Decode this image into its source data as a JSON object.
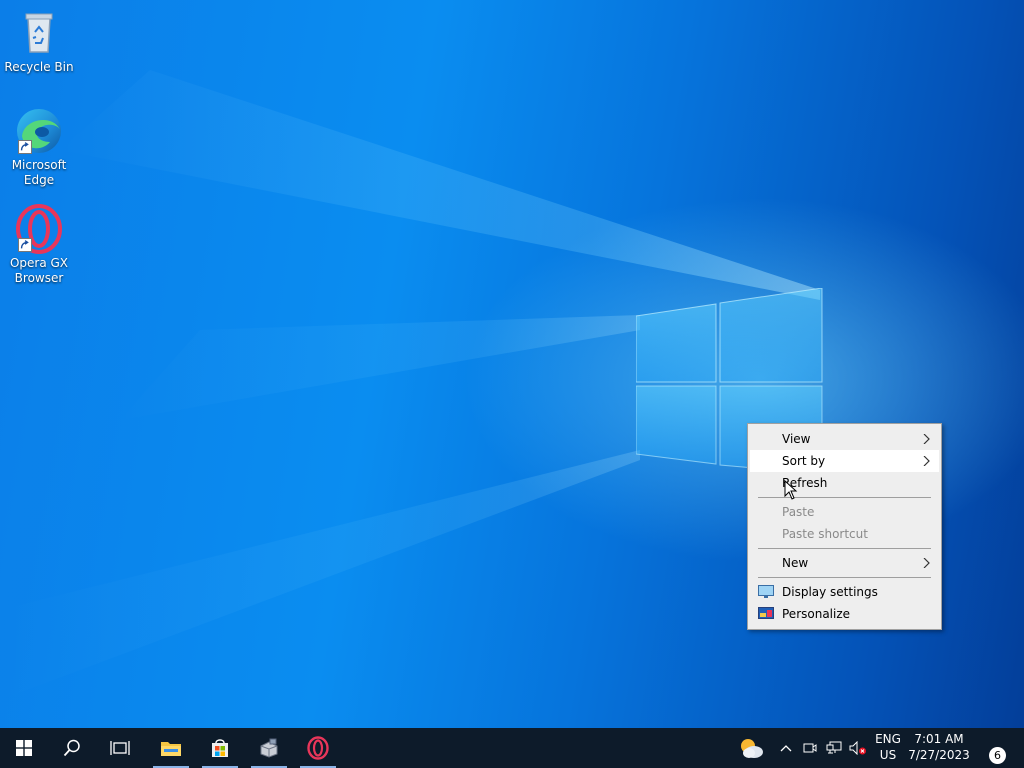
{
  "desktop": {
    "icons": [
      {
        "label_line1": "Recycle Bin",
        "label_line2": ""
      },
      {
        "label_line1": "Microsoft",
        "label_line2": "Edge"
      },
      {
        "label_line1": "Opera GX",
        "label_line2": "Browser"
      }
    ]
  },
  "context_menu": {
    "items": [
      {
        "label": "View",
        "has_submenu": true,
        "enabled": true
      },
      {
        "label": "Sort by",
        "has_submenu": true,
        "enabled": true,
        "highlighted": true
      },
      {
        "label": "Refresh",
        "has_submenu": false,
        "enabled": true
      },
      {
        "label": "Paste",
        "has_submenu": false,
        "enabled": false
      },
      {
        "label": "Paste shortcut",
        "has_submenu": false,
        "enabled": false
      },
      {
        "label": "New",
        "has_submenu": true,
        "enabled": true
      },
      {
        "label": "Display settings",
        "has_submenu": false,
        "enabled": true,
        "icon": "display-icon"
      },
      {
        "label": "Personalize",
        "has_submenu": false,
        "enabled": true,
        "icon": "personalize-icon"
      }
    ]
  },
  "taskbar": {
    "buttons": [
      {
        "name": "start",
        "icon": "windows-logo-icon"
      },
      {
        "name": "search",
        "icon": "search-icon"
      },
      {
        "name": "task-view",
        "icon": "task-view-icon"
      },
      {
        "name": "file-explorer",
        "icon": "folder-icon",
        "active": true
      },
      {
        "name": "microsoft-store",
        "icon": "store-bag-icon",
        "active": true
      },
      {
        "name": "app",
        "icon": "app-box-icon",
        "active": true
      },
      {
        "name": "opera-gx",
        "icon": "opera-icon",
        "active": true
      }
    ],
    "tray": {
      "language_line1": "ENG",
      "language_line2": "US",
      "time": "7:01 AM",
      "date": "7/27/2023",
      "notification_count": "6"
    }
  },
  "colors": {
    "desktop_blue": "#0a6fd6",
    "taskbar": "#0d1b2a",
    "menu_bg": "#eeeeee",
    "menu_hover": "#ffffff",
    "disabled_text": "#8a8a8a"
  }
}
